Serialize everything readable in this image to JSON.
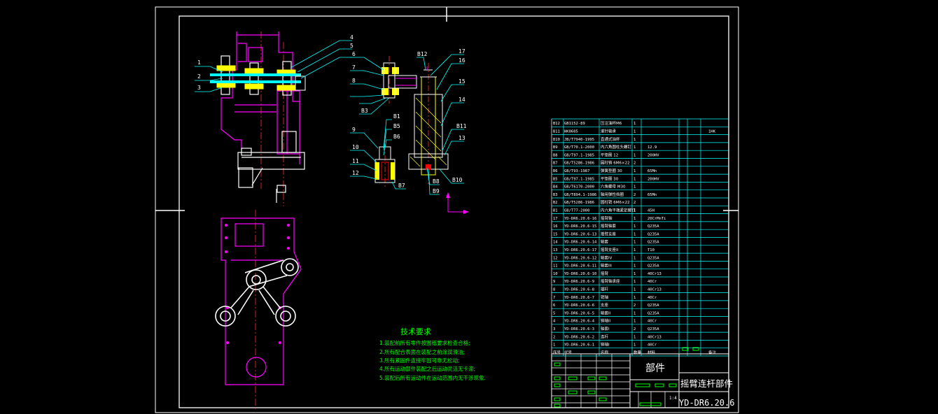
{
  "callouts_left": [
    "1",
    "2",
    "3",
    "4",
    "5"
  ],
  "callouts_mid": [
    "6",
    "7",
    "8",
    "B3"
  ],
  "callouts_lower_mid": [
    "B1",
    "B5",
    "B6",
    "9",
    "10",
    "11",
    "12",
    "B7"
  ],
  "callouts_right": [
    "B12",
    "17",
    "16",
    "15",
    "14",
    "B11",
    "13",
    "B8",
    "B9",
    "B10"
  ],
  "tech": {
    "title": "技术要求",
    "lines": [
      "1.装配前所有零件按图纸要求检查合格;",
      "2.所有配合表面在装配之前涂润滑油;",
      "3.所有紧固件连接牢固可靠无松动;",
      "4.所有运动部件装配之后运动灵活无卡滞;",
      "5.装配后所有运动件在运动范围内无干涉现象."
    ]
  },
  "bom": {
    "rows": [
      [
        "B12",
        "GB1152-89",
        "压注油杯M6",
        "1",
        "",
        "",
        ""
      ],
      [
        "B11",
        "HK0605",
        "滚针轴承",
        "1",
        "",
        "",
        "1HK"
      ],
      [
        "B10",
        "JB/T7940-1995",
        "直通式油杯",
        "1",
        "",
        "",
        ""
      ],
      [
        "B9",
        "GB/T70.1-2000",
        "内六角圆柱头螺钉",
        "1",
        "12.9",
        "",
        ""
      ],
      [
        "B8",
        "GB/T97.1-1985",
        "平垫圈 12",
        "1",
        "200HV",
        "",
        ""
      ],
      [
        "B7",
        "GB/T5286-1986",
        "圆柱销 6M6×22",
        "2",
        "",
        "",
        ""
      ],
      [
        "B6",
        "GB/T93-1987",
        "弹簧垫圈 30",
        "1",
        "65Mn",
        "",
        ""
      ],
      [
        "B5",
        "GB/T97.1-1985",
        "平垫圈 30",
        "1",
        "200HV",
        "",
        ""
      ],
      [
        "B4",
        "GB/T6170-2000",
        "六角螺母 M30",
        "1",
        "",
        "",
        ""
      ],
      [
        "B3",
        "GB/T894.1-1986",
        "轴用弹性挡圈",
        "2",
        "65Mn",
        "",
        ""
      ],
      [
        "B2",
        "GB/T5286-1986",
        "圆柱销 6M6×22",
        "2",
        "",
        "",
        ""
      ],
      [
        "B1",
        "GB/T77-2000",
        "内六角平端紧定螺钉",
        "1",
        "45H",
        "",
        ""
      ],
      [
        "17",
        "YD-DR6.20.6-16",
        "摇臂轴",
        "1",
        "20CrMnTi",
        "",
        ""
      ],
      [
        "16",
        "YD-DR6.20.6-15",
        "摇臂轴套",
        "1",
        "Q235A",
        "",
        ""
      ],
      [
        "15",
        "YD-DR6.20.6-13",
        "摇臂支座",
        "1",
        "Q235A",
        "",
        ""
      ],
      [
        "14",
        "YD-DR6.20.6-14",
        "轴套",
        "1",
        "Q235A",
        "",
        ""
      ],
      [
        "13",
        "YD-DR6.20.6-17",
        "摇臂支座II",
        "1",
        "T10",
        "",
        ""
      ],
      [
        "12",
        "YD-DR6.20.6-12",
        "轴套IV",
        "1",
        "Q235A",
        "",
        ""
      ],
      [
        "11",
        "YD-DR6.20.6-11",
        "轴套III",
        "1",
        "Q235A",
        "",
        ""
      ],
      [
        "10",
        "YD-DR6.20.6-10",
        "摇臂",
        "1",
        "40Cr13",
        "",
        ""
      ],
      [
        "9",
        "YD-DR6.20.6-9",
        "摇臂轴承座",
        "1",
        "40Cr",
        "",
        ""
      ],
      [
        "8",
        "YD-DR6.20.6-8",
        "摆杆",
        "1",
        "40Cr13",
        "",
        ""
      ],
      [
        "7",
        "YD-DR6.20.6-7",
        "销轴",
        "1",
        "40Cr",
        "",
        ""
      ],
      [
        "6",
        "YD-DR6.20.6-6",
        "支座",
        "2",
        "Q235A",
        "",
        ""
      ],
      [
        "5",
        "YD-DR6.20.6-5",
        "轴套II",
        "1",
        "Q235A",
        "",
        ""
      ],
      [
        "4",
        "YD-DR6.20.6-4",
        "销轴II",
        "1",
        "40Cr",
        "",
        ""
      ],
      [
        "3",
        "YD-DR6.20.6-3",
        "轴套I",
        "2",
        "Q235A",
        "",
        ""
      ],
      [
        "2",
        "YD-DR6.20.6-2",
        "连杆",
        "1",
        "40Cr13",
        "",
        ""
      ],
      [
        "1",
        "YD-DR6.20.6-1",
        "销轴I",
        "1",
        "40Cr",
        "",
        ""
      ]
    ],
    "header": [
      "序号",
      "代号",
      "名称",
      "数量",
      "材料",
      "",
      "备注"
    ]
  },
  "title_block": {
    "category": "部件",
    "name": "摇臂连杆部件",
    "drawing_no": "YD-DR6.20.6",
    "scale": "1:4"
  }
}
